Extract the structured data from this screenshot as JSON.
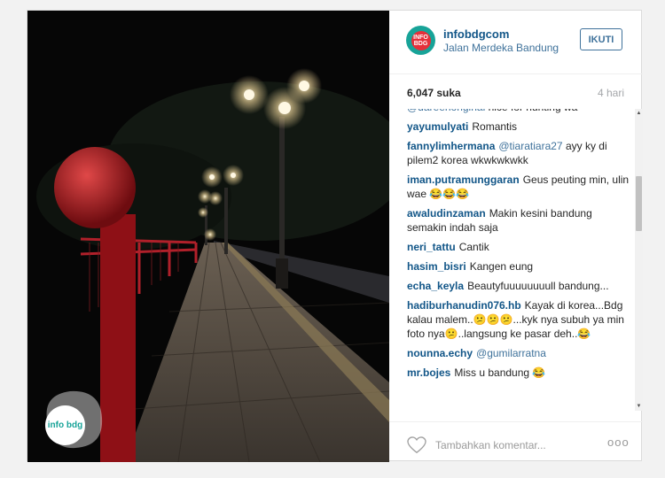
{
  "post": {
    "username": "infobdgcom",
    "location": "Jalan Merdeka Bandung",
    "follow_label": "IKUTI",
    "likes": "6,047 suka",
    "time_ago": "4 hari",
    "avatar_text": "INFO BDG",
    "watermark_text": "info bdg"
  },
  "comments": [
    {
      "user": "",
      "mention": "@dareenoriginal",
      "text": "nice for hunting wa"
    },
    {
      "user": "yayumulyati",
      "mention": "",
      "text": "Romantis"
    },
    {
      "user": "fannylimhermana",
      "mention": "@tiaratiara27",
      "text": "ayy ky di pilem2 korea wkwkwkwkk"
    },
    {
      "user": "iman.putramunggaran",
      "mention": "",
      "text": "Geus peuting min, ulin wae 😂😂😂"
    },
    {
      "user": "awaludinzaman",
      "mention": "",
      "text": "Makin kesini bandung semakin indah saja"
    },
    {
      "user": "neri_tattu",
      "mention": "",
      "text": "Cantik"
    },
    {
      "user": "hasim_bisri",
      "mention": "",
      "text": "Kangen eung"
    },
    {
      "user": "echa_keyla",
      "mention": "",
      "text": "Beautyfuuuuuuuull bandung..."
    },
    {
      "user": "hadiburhanudin076.hb",
      "mention": "",
      "text": "Kayak di korea...Bdg kalau malem..😕😕😕...kyk nya subuh ya min foto nya😕..langsung ke pasar deh..😂"
    },
    {
      "user": "nounna.echy",
      "mention": "@gumilarratna",
      "text": ""
    },
    {
      "user": "mr.bojes",
      "mention": "",
      "text": "Miss u bandung 😂"
    }
  ],
  "footer": {
    "comment_placeholder": "Tambahkan komentar...",
    "more_label": "ooo"
  },
  "colors": {
    "link": "#125688",
    "mention": "#3f729b",
    "brand_teal": "#17a398",
    "brand_red": "#e5303a"
  },
  "icons": [
    "heart-icon",
    "more-options-icon",
    "scroll-up-icon",
    "scroll-down-icon"
  ]
}
